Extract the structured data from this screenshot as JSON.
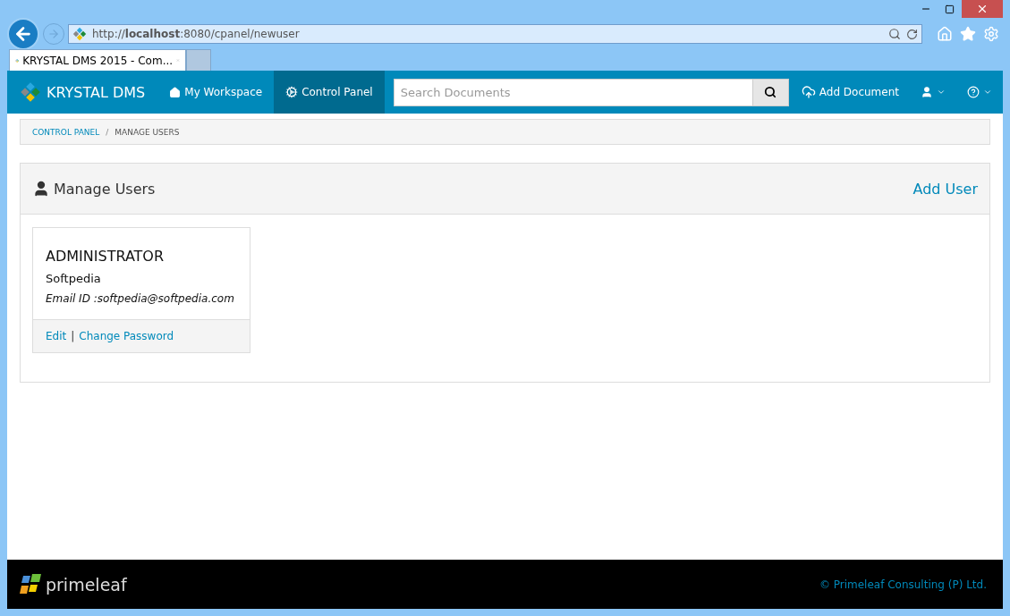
{
  "browser": {
    "url": "http://**localhost**:8080/cpanel/newuser",
    "tabs": [
      {
        "title": "KRYSTAL DMS 2015 - Com...",
        "selected": true
      },
      {
        "selected": false
      }
    ]
  },
  "navbar": {
    "brand": "KRYSTAL DMS",
    "items": [
      {
        "label": "My Workspace",
        "kind": "home",
        "selected": false
      },
      {
        "label": "Control Panel",
        "kind": "gears",
        "selected": true
      }
    ],
    "search": {
      "placeholder": "Search Documents"
    },
    "add_document": "Add Document"
  },
  "breadcrumb": [
    {
      "label": "CONTROL PANEL",
      "kind": "link"
    },
    {
      "label": "/",
      "kind": "divider"
    },
    {
      "label": "MANAGE USERS",
      "kind": "current"
    }
  ],
  "panel": {
    "title": "Manage Users",
    "action": "Add User",
    "users": [
      {
        "name": "ADMINISTRATOR",
        "organization": "Softpedia",
        "email": "Email ID :softpedia@softpedia.com",
        "links": [
          "Edit",
          "Change Password"
        ],
        "separator": "|"
      }
    ]
  },
  "footer": {
    "logo": "primeleaf",
    "copyright": "© Primeleaf Consulting (P) Ltd."
  }
}
